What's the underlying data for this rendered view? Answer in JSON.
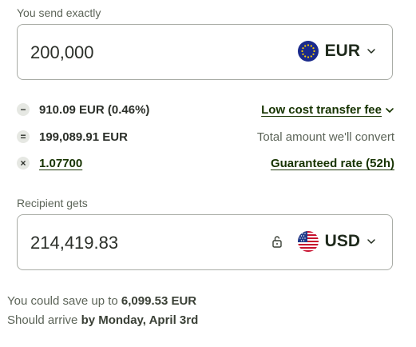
{
  "send": {
    "label": "You send exactly",
    "amount": "200,000",
    "currency": "EUR",
    "flag_icon": "eu-flag-icon"
  },
  "fees": [
    {
      "operator": "−",
      "text": "910.09 EUR (0.46%)",
      "right": "Low cost transfer fee",
      "right_has_chevron": true
    },
    {
      "operator": "=",
      "text": "199,089.91 EUR",
      "right": "Total amount we'll convert"
    },
    {
      "operator": "×",
      "text": "1.07700",
      "right": "Guaranteed rate (52h)"
    }
  ],
  "receive": {
    "label": "Recipient gets",
    "amount": "214,419.83",
    "currency": "USD",
    "flag_icon": "us-flag-icon",
    "lock_icon": "unlock-icon"
  },
  "footer": {
    "save_prefix": "You could save up to",
    "save_amount": "6,099.53 EUR",
    "arrive_prefix": "Should arrive",
    "arrive_value": "by Monday, April 3rd"
  },
  "colors": {
    "text": "#1f2a1c",
    "muted": "#5c6458",
    "link": "#163300",
    "border": "#a9aca6"
  }
}
